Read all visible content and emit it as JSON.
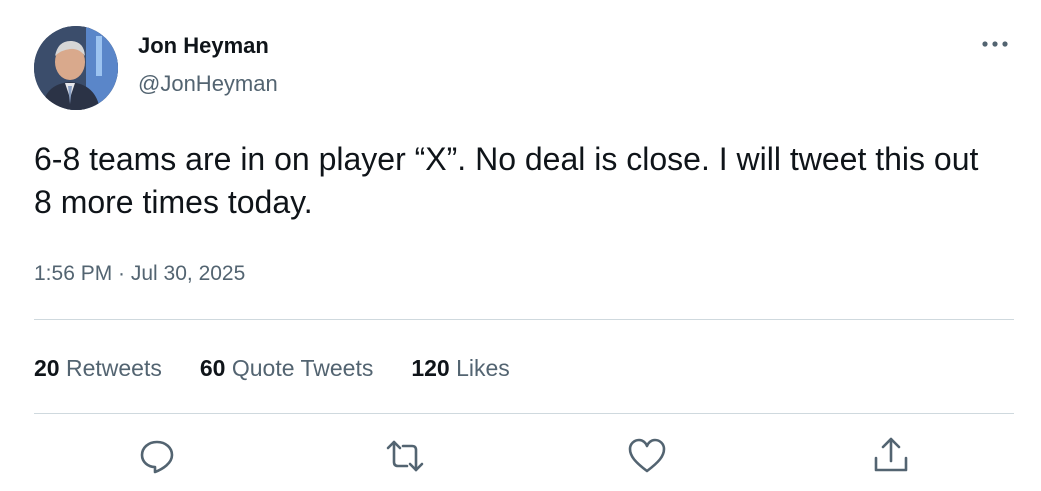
{
  "author": {
    "display_name": "Jon Heyman",
    "handle": "@JonHeyman"
  },
  "tweet": {
    "text": "6-8 teams are in on player “X”. No deal is close. I will tweet this out 8 more times today.",
    "timestamp": "1:56 PM · Jul 30, 2025"
  },
  "stats": {
    "retweets_count": "20",
    "retweets_label": "Retweets",
    "quotes_count": "60",
    "quotes_label": "Quote Tweets",
    "likes_count": "120",
    "likes_label": "Likes"
  },
  "icons": {
    "more": "more-horizontal-icon",
    "reply": "reply-icon",
    "retweet": "retweet-icon",
    "like": "heart-icon",
    "share": "share-icon"
  },
  "colors": {
    "text_primary": "#0f1419",
    "text_secondary": "#536471",
    "divider": "#cfd9de",
    "icon": "#536471"
  }
}
